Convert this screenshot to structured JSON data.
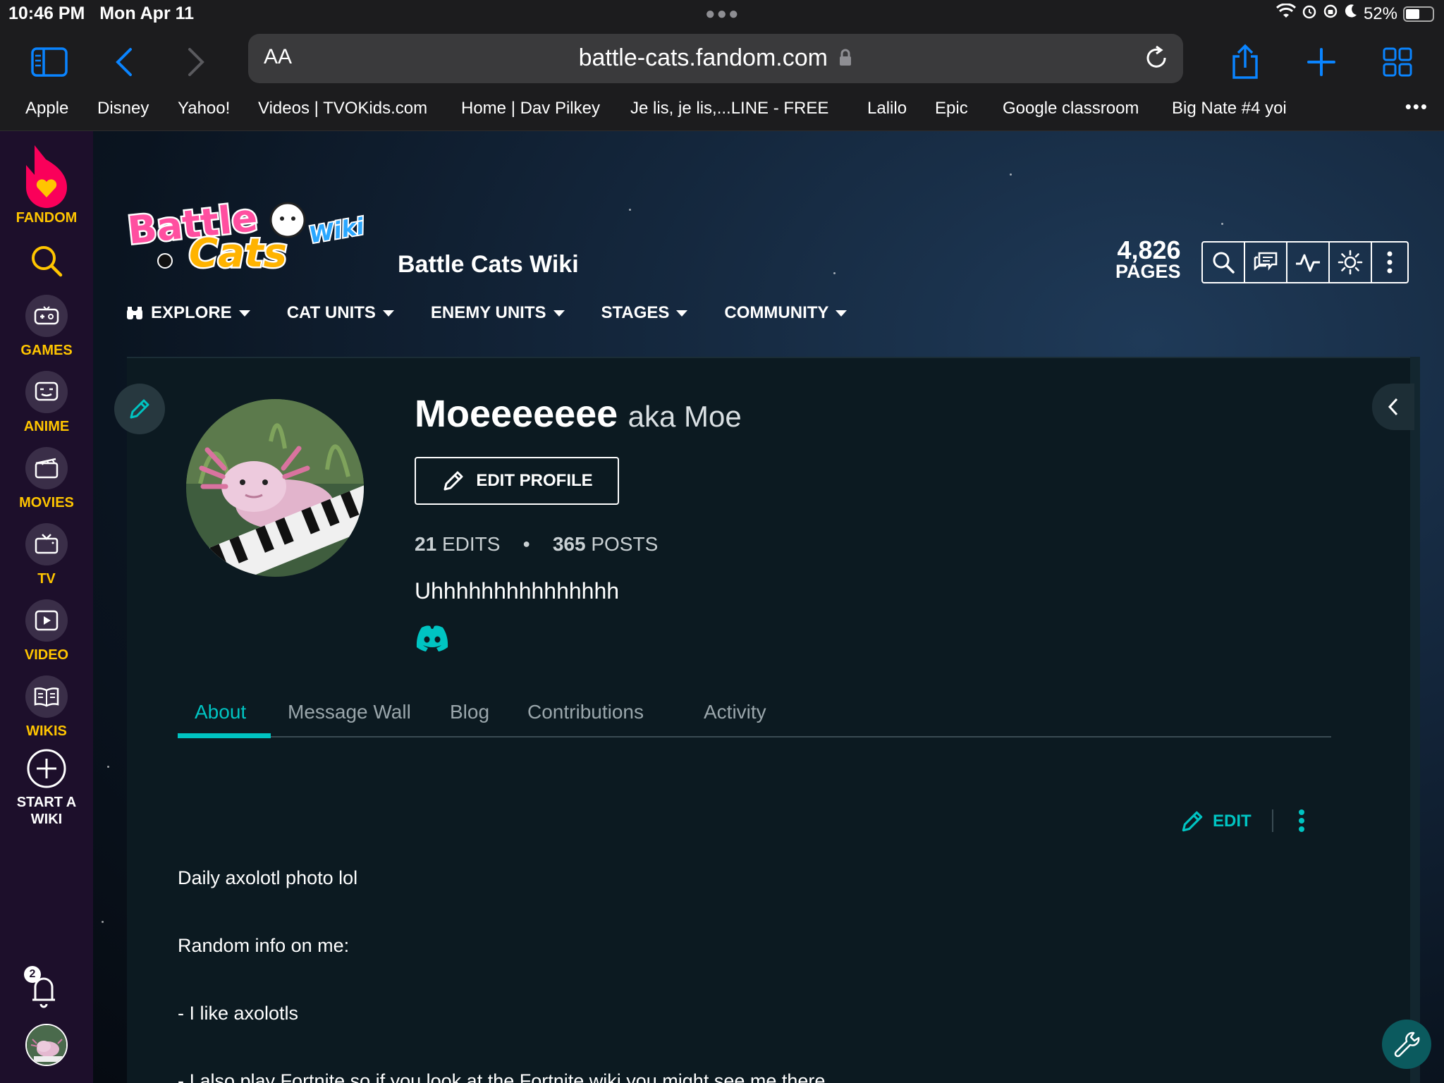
{
  "status": {
    "time": "10:46 PM",
    "date": "Mon Apr 11",
    "battery": "52%",
    "battery_level": 0.52
  },
  "browser": {
    "text_size_label": "AA",
    "url": "battle-cats.fandom.com",
    "favorites": [
      {
        "label": "Apple"
      },
      {
        "label": "Disney"
      },
      {
        "label": "Yahoo!"
      },
      {
        "label": "Videos | TVOKids.com"
      },
      {
        "label": "Home | Dav Pilkey"
      },
      {
        "label": "Je lis, je lis,...LINE - FREE"
      },
      {
        "label": "Lalilo"
      },
      {
        "label": "Epic"
      },
      {
        "label": "Google classroom"
      },
      {
        "label": "Big Nate #4 yoi"
      }
    ]
  },
  "rail": {
    "brand": "FANDOM",
    "items": [
      {
        "label": "GAMES",
        "icon": "gamepad-icon"
      },
      {
        "label": "ANIME",
        "icon": "anime-icon"
      },
      {
        "label": "MOVIES",
        "icon": "clapperboard-icon"
      },
      {
        "label": "TV",
        "icon": "tv-icon"
      },
      {
        "label": "VIDEO",
        "icon": "play-icon"
      },
      {
        "label": "WIKIS",
        "icon": "book-icon"
      }
    ],
    "start_wiki": "START A WIKI",
    "notifications_count": "2"
  },
  "wiki": {
    "name": "Battle Cats Wiki",
    "pages_count": "4,826",
    "pages_label": "PAGES",
    "nav": [
      {
        "label": "EXPLORE"
      },
      {
        "label": "CAT UNITS"
      },
      {
        "label": "ENEMY UNITS"
      },
      {
        "label": "STAGES"
      },
      {
        "label": "COMMUNITY"
      }
    ]
  },
  "profile": {
    "username": "Moeeeeeee",
    "aka_label": "aka",
    "aka": "Moe",
    "edit_profile": "EDIT PROFILE",
    "edits_count": "21",
    "edits_label": "EDITS",
    "posts_count": "365",
    "posts_label": "POSTS",
    "bio": "Uhhhhhhhhhhhhhhh",
    "tabs": [
      {
        "label": "About",
        "active": true
      },
      {
        "label": "Message Wall"
      },
      {
        "label": "Blog"
      },
      {
        "label": "Contributions"
      },
      {
        "label": "Activity"
      }
    ],
    "about_edit": "EDIT",
    "about_lines": [
      "Daily axolotl photo lol",
      "Random info on me:",
      "- I like axolotls",
      "- I also play Fortnite so if you look at the Fortnite wiki you might see me there"
    ]
  },
  "colors": {
    "accent": "#00c4c2",
    "fandom_yellow": "#ffc500",
    "fandom_pink": "#fa005a",
    "rail_bg": "#1d0f2b",
    "safari_blue": "#0a84ff"
  }
}
